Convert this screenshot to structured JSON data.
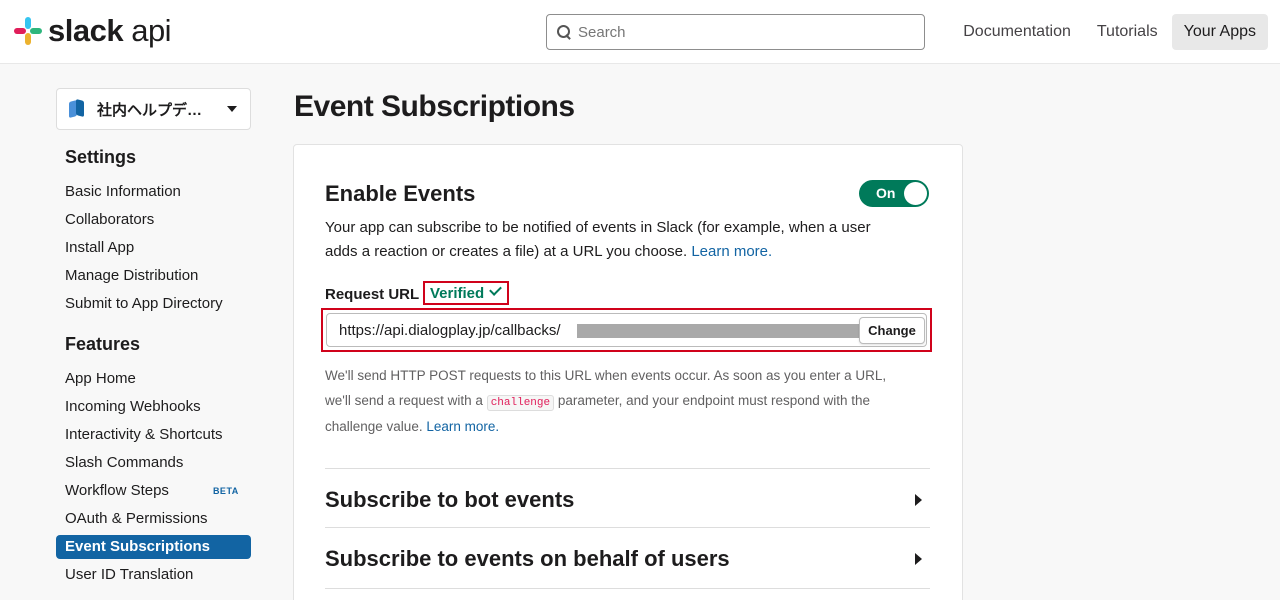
{
  "header": {
    "logo_bold": "slack",
    "logo_light": "api",
    "search_placeholder": "Search",
    "nav": [
      "Documentation",
      "Tutorials",
      "Your Apps"
    ]
  },
  "sidebar": {
    "app_name": "社内ヘルプデ…",
    "settings_heading": "Settings",
    "settings_items": [
      "Basic Information",
      "Collaborators",
      "Install App",
      "Manage Distribution",
      "Submit to App Directory"
    ],
    "features_heading": "Features",
    "features_items": [
      "App Home",
      "Incoming Webhooks",
      "Interactivity & Shortcuts",
      "Slash Commands",
      "Workflow Steps",
      "OAuth & Permissions",
      "Event Subscriptions",
      "User ID Translation"
    ],
    "beta_label": "BETA",
    "active_item": "Event Subscriptions"
  },
  "main": {
    "page_title": "Event Subscriptions",
    "enable": {
      "title": "Enable Events",
      "toggle_label": "On",
      "desc_line1": "Your app can subscribe to be notified of events in Slack (for example, when a user",
      "desc_line2": "adds a reaction or creates a file) at a URL you choose.",
      "learn_more": "Learn more."
    },
    "request_url": {
      "label": "Request URL",
      "status": "Verified",
      "value": "https://api.dialogplay.jp/callbacks/",
      "change_button": "Change"
    },
    "help": {
      "line1": "We'll send HTTP POST requests to this URL when events occur. As soon as you enter a URL,",
      "line2_pre": "we'll send a request with a",
      "code": "challenge",
      "line2_post": "parameter, and your endpoint must respond with the",
      "line3": "challenge value.",
      "learn_more": "Learn more."
    },
    "sections": [
      "Subscribe to bot events",
      "Subscribe to events on behalf of users"
    ]
  },
  "colors": {
    "accent_blue": "#1264a3",
    "toggle_green": "#007a5a",
    "highlight_red": "#d0021b"
  }
}
